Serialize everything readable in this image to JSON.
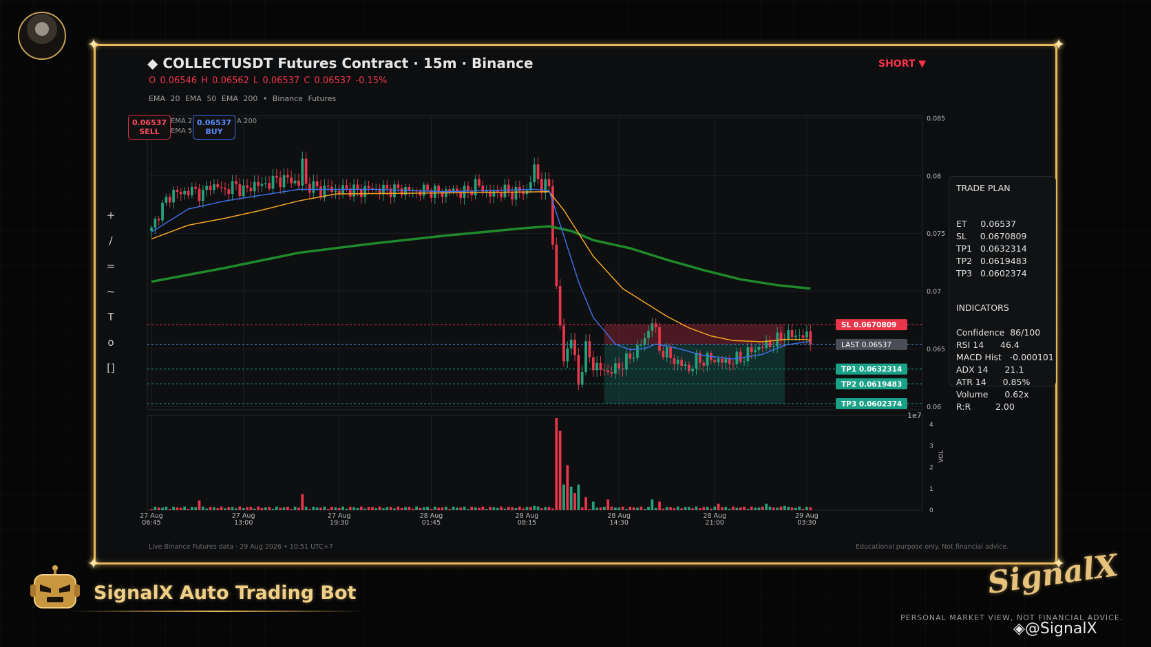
{
  "header": {
    "title": "◆  COLLECTUSDT Futures Contract  ·  15m  ·  Binance",
    "ohlc": "O 0.06546   H 0.06562   L 0.06537   C 0.06537   -0.15%",
    "ema_legend": "EMA 20    EMA 50    EMA 200    •    Binance Futures",
    "direction": "SHORT ▼"
  },
  "toolbar": {
    "tools": [
      "+",
      "/",
      "=",
      "~",
      "T",
      "o",
      "[]"
    ]
  },
  "quote_boxes": {
    "sell_price": "0.06537",
    "sell_label": "SELL",
    "buy_price": "0.06537",
    "buy_label": "BUY",
    "mini_legend_1": "EMA 2",
    "mini_legend_2": "EMA 5",
    "mini_legend_3": "A 200"
  },
  "trade_plan": {
    "title": "TRADE PLAN",
    "lines": "ET     0.06537\nSL     0.0670809\nTP1   0.0632314\nTP2   0.0619483\nTP3   0.0602374",
    "indicators_title": "INDICATORS",
    "indicators": "Confidence  86/100\nRSI 14      46.4\nMACD Hist   -0.000101\nADX 14      21.1\nATR 14      0.85%\nVolume      0.62x\nR:R         2.00"
  },
  "footer": {
    "left": "Live Binance Futures data   ·   29 Aug 2026 • 10:51 UTC+7",
    "right": "Educational purpose only. Not financial advice."
  },
  "branding": {
    "bot_name": "SignalX Auto Trading Bot",
    "logo": "SignalX",
    "disclaimer": "PERSONAL MARKET VIEW, NOT FINANCIAL ADVICE.",
    "handle": "@SignalX"
  },
  "colors": {
    "bull": "#26a17b",
    "bear": "#e8364a",
    "ema20": "#3d6fe6",
    "ema50": "#f5a623",
    "ema200": "#1f8a2b",
    "frame": "#e8b85a"
  },
  "chart_data": {
    "type": "candlestick",
    "title": "",
    "xlabel": "",
    "ylabel": "",
    "ylim": [
      0.0597,
      0.0852
    ],
    "y_ticks": [
      "0.085",
      "0.08",
      "0.075",
      "0.07",
      "0.065",
      "0.06"
    ],
    "y_tick_values": [
      0.085,
      0.08,
      0.075,
      0.07,
      0.065,
      0.06
    ],
    "y_exponent_label": "1e7",
    "x_ticks": [
      {
        "label1": "27 Aug",
        "label2": "06:45",
        "t": 0
      },
      {
        "label1": "27 Aug",
        "label2": "13:00",
        "t": 25
      },
      {
        "label1": "27 Aug",
        "label2": "19:30",
        "t": 51
      },
      {
        "label1": "28 Aug",
        "label2": "01:45",
        "t": 76
      },
      {
        "label1": "28 Aug",
        "label2": "08:15",
        "t": 102
      },
      {
        "label1": "28 Aug",
        "label2": "14:30",
        "t": 127
      },
      {
        "label1": "28 Aug",
        "label2": "21:00",
        "t": 153
      },
      {
        "label1": "29 Aug",
        "label2": "03:30",
        "t": 178
      }
    ],
    "close_path": [
      [
        0,
        0.0752
      ],
      [
        2,
        0.0768
      ],
      [
        4,
        0.0778
      ],
      [
        6,
        0.0786
      ],
      [
        8,
        0.0784
      ],
      [
        10,
        0.0787
      ],
      [
        12,
        0.0786
      ],
      [
        14,
        0.0784
      ],
      [
        16,
        0.0792
      ],
      [
        18,
        0.079
      ],
      [
        20,
        0.0787
      ],
      [
        22,
        0.0791
      ],
      [
        24,
        0.0789
      ],
      [
        26,
        0.0787
      ],
      [
        28,
        0.0793
      ],
      [
        30,
        0.0791
      ],
      [
        32,
        0.0794
      ],
      [
        34,
        0.0796
      ],
      [
        36,
        0.0797
      ],
      [
        38,
        0.0796
      ],
      [
        40,
        0.0793
      ],
      [
        41,
        0.0812
      ],
      [
        42,
        0.0792
      ],
      [
        44,
        0.079
      ],
      [
        46,
        0.0787
      ],
      [
        48,
        0.0789
      ],
      [
        50,
        0.0786
      ],
      [
        52,
        0.0788
      ],
      [
        54,
        0.0788
      ],
      [
        56,
        0.0786
      ],
      [
        58,
        0.0788
      ],
      [
        60,
        0.0789
      ],
      [
        62,
        0.0787
      ],
      [
        64,
        0.0788
      ],
      [
        66,
        0.0787
      ],
      [
        68,
        0.0788
      ],
      [
        70,
        0.0787
      ],
      [
        72,
        0.0786
      ],
      [
        74,
        0.0787
      ],
      [
        76,
        0.0787
      ],
      [
        78,
        0.0785
      ],
      [
        80,
        0.0786
      ],
      [
        82,
        0.0787
      ],
      [
        84,
        0.0785
      ],
      [
        86,
        0.0786
      ],
      [
        88,
        0.0792
      ],
      [
        90,
        0.0789
      ],
      [
        92,
        0.0783
      ],
      [
        94,
        0.0786
      ],
      [
        96,
        0.0786
      ],
      [
        98,
        0.0785
      ],
      [
        100,
        0.0786
      ],
      [
        102,
        0.0786
      ],
      [
        104,
        0.0806
      ],
      [
        106,
        0.079
      ],
      [
        108,
        0.0791
      ],
      [
        110,
        0.07
      ],
      [
        112,
        0.064
      ],
      [
        114,
        0.066
      ],
      [
        116,
        0.062
      ],
      [
        118,
        0.065
      ],
      [
        120,
        0.0636
      ],
      [
        122,
        0.0632
      ],
      [
        124,
        0.063
      ],
      [
        126,
        0.0632
      ],
      [
        128,
        0.0637
      ],
      [
        130,
        0.0642
      ],
      [
        132,
        0.065
      ],
      [
        134,
        0.0658
      ],
      [
        136,
        0.0675
      ],
      [
        138,
        0.065
      ],
      [
        140,
        0.0645
      ],
      [
        142,
        0.064
      ],
      [
        144,
        0.0636
      ],
      [
        146,
        0.0632
      ],
      [
        148,
        0.064
      ],
      [
        150,
        0.064
      ],
      [
        152,
        0.0641
      ],
      [
        154,
        0.064
      ],
      [
        156,
        0.0638
      ],
      [
        158,
        0.064
      ],
      [
        160,
        0.0641
      ],
      [
        162,
        0.0646
      ],
      [
        164,
        0.065
      ],
      [
        166,
        0.0652
      ],
      [
        168,
        0.0654
      ],
      [
        170,
        0.0657
      ],
      [
        172,
        0.0662
      ],
      [
        174,
        0.0661
      ],
      [
        176,
        0.0662
      ],
      [
        178,
        0.066
      ],
      [
        179,
        0.06537
      ]
    ],
    "candle_count": 180,
    "ema20": [
      [
        0,
        0.0751
      ],
      [
        10,
        0.0771
      ],
      [
        20,
        0.0778
      ],
      [
        30,
        0.0783
      ],
      [
        40,
        0.0788
      ],
      [
        50,
        0.0788
      ],
      [
        60,
        0.0788
      ],
      [
        80,
        0.0786
      ],
      [
        104,
        0.0788
      ],
      [
        108,
        0.0787
      ],
      [
        112,
        0.0748
      ],
      [
        116,
        0.0708
      ],
      [
        120,
        0.0677
      ],
      [
        126,
        0.0654
      ],
      [
        130,
        0.0649
      ],
      [
        134,
        0.065
      ],
      [
        137,
        0.0654
      ],
      [
        142,
        0.0651
      ],
      [
        150,
        0.0644
      ],
      [
        158,
        0.0641
      ],
      [
        166,
        0.0645
      ],
      [
        172,
        0.0653
      ],
      [
        178,
        0.0656
      ],
      [
        179,
        0.06555
      ]
    ],
    "ema50": [
      [
        0,
        0.0745
      ],
      [
        10,
        0.0757
      ],
      [
        20,
        0.0763
      ],
      [
        30,
        0.077
      ],
      [
        40,
        0.0778
      ],
      [
        50,
        0.0784
      ],
      [
        80,
        0.0785
      ],
      [
        108,
        0.0786
      ],
      [
        112,
        0.077
      ],
      [
        120,
        0.073
      ],
      [
        128,
        0.0702
      ],
      [
        134,
        0.069
      ],
      [
        140,
        0.0678
      ],
      [
        146,
        0.0668
      ],
      [
        152,
        0.0661
      ],
      [
        158,
        0.0657
      ],
      [
        166,
        0.0656
      ],
      [
        172,
        0.0658
      ],
      [
        178,
        0.0658
      ],
      [
        179,
        0.0657
      ]
    ],
    "ema200": [
      [
        0,
        0.0708
      ],
      [
        20,
        0.072
      ],
      [
        40,
        0.0733
      ],
      [
        60,
        0.0741
      ],
      [
        80,
        0.0748
      ],
      [
        100,
        0.0754
      ],
      [
        108,
        0.0756
      ],
      [
        114,
        0.0752
      ],
      [
        120,
        0.0744
      ],
      [
        130,
        0.0737
      ],
      [
        140,
        0.0727
      ],
      [
        150,
        0.0718
      ],
      [
        160,
        0.071
      ],
      [
        170,
        0.0705
      ],
      [
        179,
        0.0702
      ]
    ],
    "levels": [
      {
        "name": "SL",
        "value": 0.0670809,
        "label": "SL  0.0670809",
        "color": "#e8364a"
      },
      {
        "name": "LAST",
        "value": 0.06537,
        "label": "LAST  0.06537",
        "color": "#4a4d55"
      },
      {
        "name": "TP1",
        "value": 0.0632314,
        "label": "TP1  0.0632314",
        "color": "#1aa187"
      },
      {
        "name": "TP2",
        "value": 0.0619483,
        "label": "TP2  0.0619483",
        "color": "#1aa187"
      },
      {
        "name": "TP3",
        "value": 0.0602374,
        "label": "TP3  0.0602374",
        "color": "#1aa187"
      }
    ],
    "zone_t_range": [
      123,
      172
    ],
    "volume": {
      "ylim": [
        0,
        4.3
      ],
      "y_ticks": [
        "4",
        "3",
        "2",
        "1",
        "0"
      ],
      "y_tick_values": [
        4,
        3,
        2,
        1,
        0
      ],
      "ylabel": "VOL",
      "spikes": [
        [
          13,
          0.45,
          "bear"
        ],
        [
          41,
          0.75,
          "bear"
        ],
        [
          104,
          0.2,
          "bull"
        ],
        [
          110,
          4.3,
          "bear"
        ],
        [
          111,
          3.7,
          "bear"
        ],
        [
          112,
          1.2,
          "bull"
        ],
        [
          113,
          2.1,
          "bear"
        ],
        [
          114,
          1.1,
          "bull"
        ],
        [
          115,
          0.8,
          "bear"
        ],
        [
          116,
          1.2,
          "bull"
        ],
        [
          118,
          0.6,
          "bear"
        ],
        [
          120,
          0.4,
          "bull"
        ],
        [
          124,
          0.5,
          "bear"
        ],
        [
          136,
          0.5,
          "bull"
        ],
        [
          138,
          0.4,
          "bear"
        ],
        [
          154,
          0.3,
          "bear"
        ],
        [
          167,
          0.3,
          "bull"
        ],
        [
          172,
          0.2,
          "bull"
        ]
      ]
    }
  }
}
